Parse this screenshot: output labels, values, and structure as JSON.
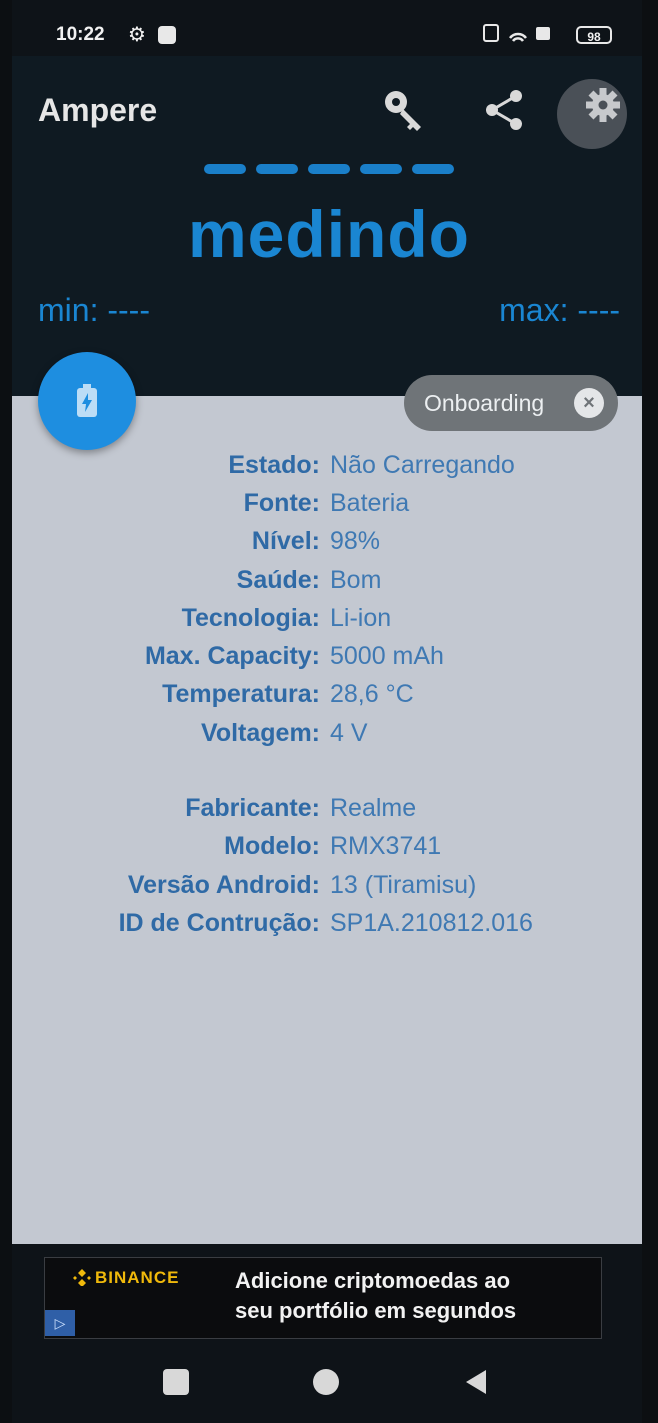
{
  "status_bar": {
    "time": "10:22",
    "battery": "98"
  },
  "header": {
    "app_title": "Ampere",
    "measure_status": "medindo",
    "min_label": "min: ----",
    "max_label": "max: ----",
    "icons": [
      "key-icon",
      "share-icon",
      "gear-icon"
    ]
  },
  "onboarding": {
    "label": "Onboarding"
  },
  "info": {
    "battery_rows": [
      {
        "key": "Estado:",
        "value": "Não Carregando"
      },
      {
        "key": "Fonte:",
        "value": "Bateria"
      },
      {
        "key": "Nível:",
        "value": "98%"
      },
      {
        "key": "Saúde:",
        "value": "Bom"
      },
      {
        "key": "Tecnologia:",
        "value": "Li-ion"
      },
      {
        "key": "Max. Capacity:",
        "value": "5000 mAh"
      },
      {
        "key": "Temperatura:",
        "value": "28,6 °C"
      },
      {
        "key": "Voltagem:",
        "value": "4 V"
      }
    ],
    "device_rows": [
      {
        "key": "Fabricante:",
        "value": "Realme"
      },
      {
        "key": "Modelo:",
        "value": "RMX3741"
      },
      {
        "key": "Versão Android:",
        "value": "13 (Tiramisu)"
      },
      {
        "key": "ID de Contrução:",
        "value": "SP1A.210812.016"
      }
    ]
  },
  "ad": {
    "brand": "BINANCE",
    "line1": "Adicione criptomoedas ao",
    "line2": "seu portfólio em segundos"
  },
  "colors": {
    "accent": "#1a86d2",
    "panel_bg": "#c3c8d1",
    "ad_brand": "#f0b90b"
  }
}
